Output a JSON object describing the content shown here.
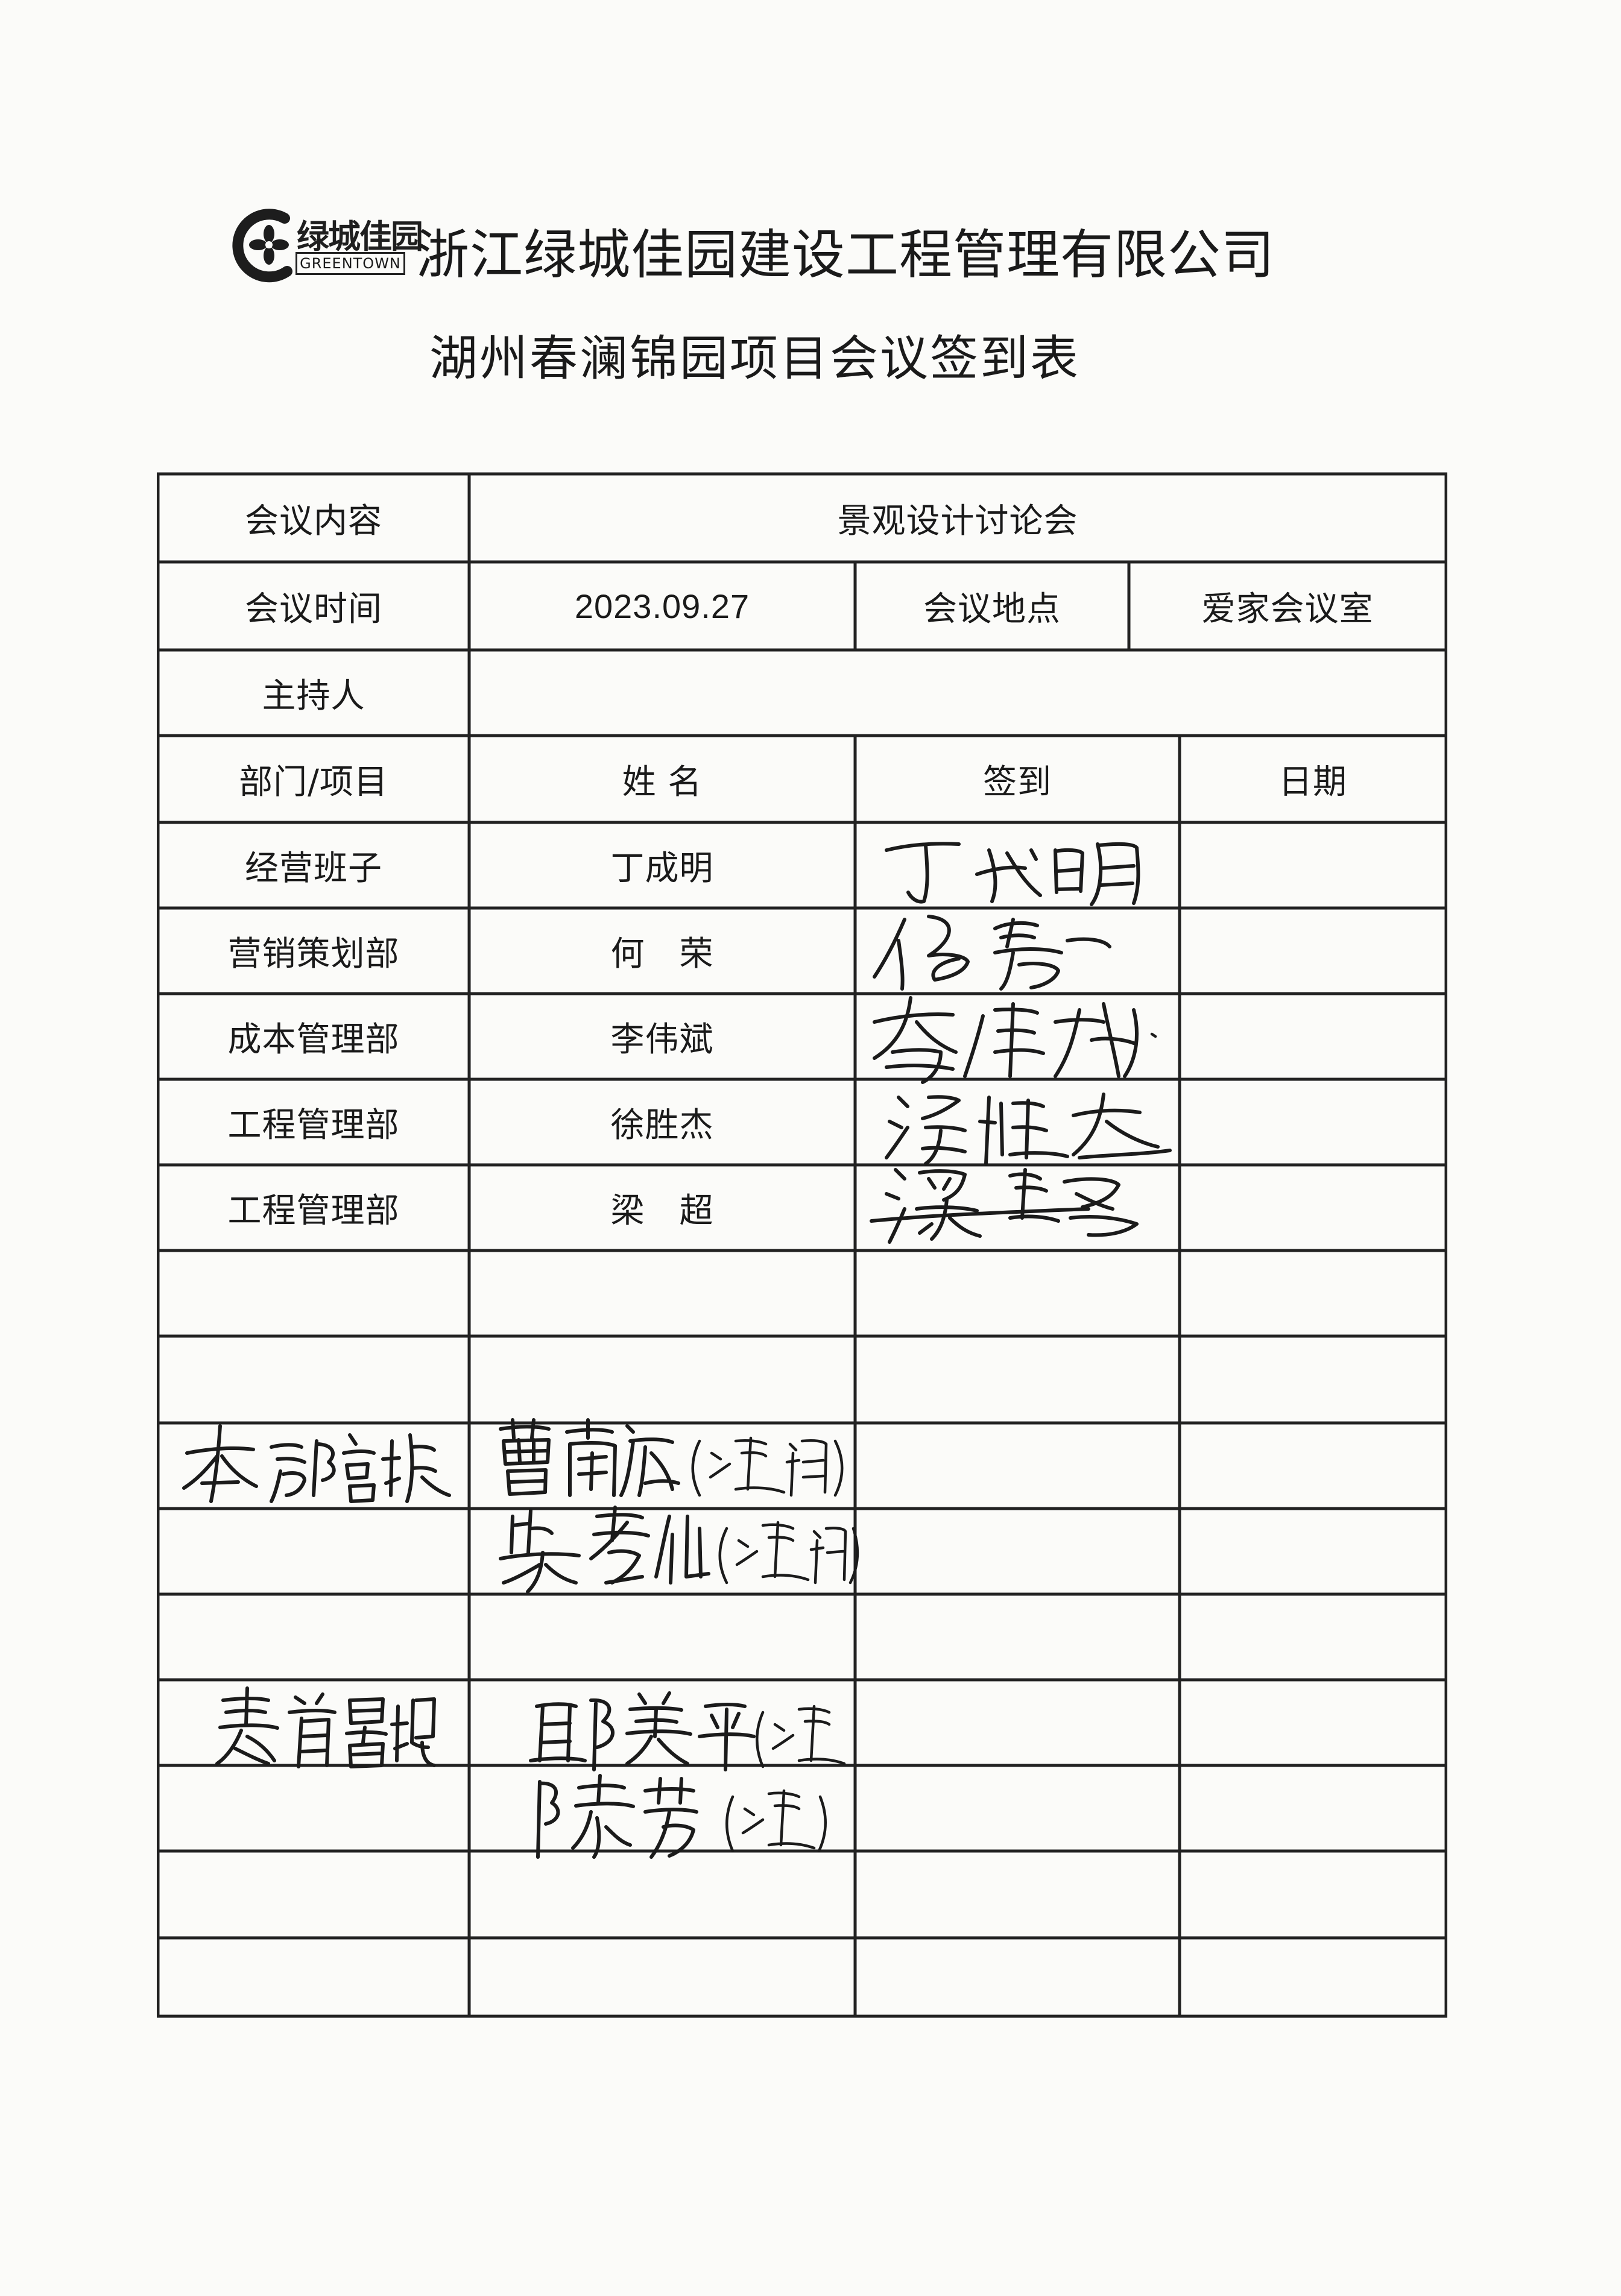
{
  "header": {
    "logo_cn": "绿城佳园",
    "logo_en": "GREENTOWN",
    "company": "浙江绿城佳园建设工程管理有限公司",
    "title": "湖州春澜锦园项目会议签到表"
  },
  "meta": {
    "content_label": "会议内容",
    "content_value": "景观设计讨论会",
    "time_label": "会议时间",
    "time_value": "2023.09.27",
    "place_label": "会议地点",
    "place_value": "爱家会议室",
    "host_label": "主持人",
    "host_value": ""
  },
  "columns": [
    "部门/项目",
    "姓 名",
    "签到",
    "日期"
  ],
  "rows": [
    {
      "dept": "经营班子",
      "name": "丁成明",
      "signed": "丁成明"
    },
    {
      "dept": "营销策划部",
      "name": "何　荣",
      "signed": "何荣"
    },
    {
      "dept": "成本管理部",
      "name": "李伟斌",
      "signed": "李伟斌"
    },
    {
      "dept": "工程管理部",
      "name": "徐胜杰",
      "signed": "徐胜杰"
    },
    {
      "dept": "工程管理部",
      "name": "梁　超",
      "signed": "梁超"
    }
  ],
  "handwritten_entries": [
    {
      "dept": "本部品中心",
      "names": [
        "曹南宏（远程）",
        "柴孝仙（远程）"
      ]
    },
    {
      "dept": "麦肯景观",
      "names": [
        "邱美平（远程）",
        "陈芳（远程）"
      ]
    }
  ]
}
